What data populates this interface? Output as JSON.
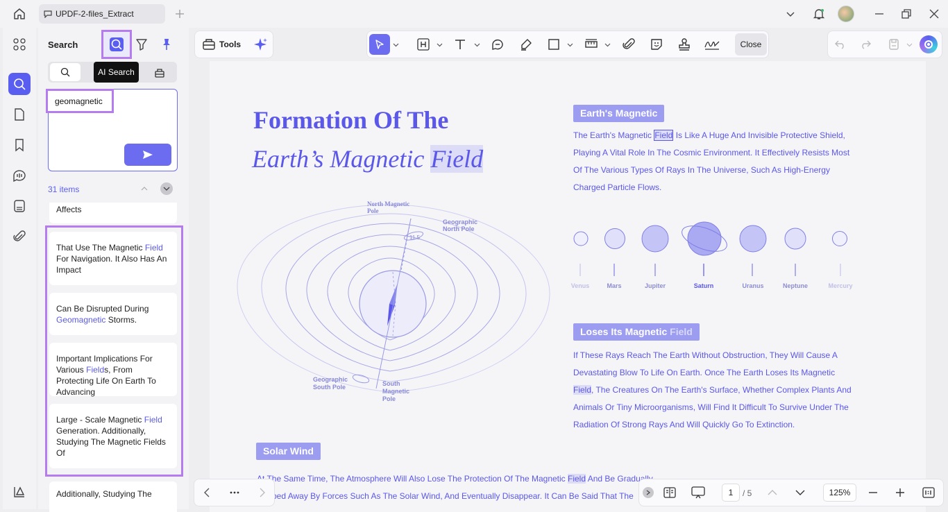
{
  "window": {
    "tab_title": "UPDF-2-files_Extract"
  },
  "search_panel": {
    "title": "Search",
    "tooltip": "AI Search",
    "query": "geomagnetic",
    "items_count": "31 items",
    "partial_top": "Affects",
    "results": [
      {
        "pre": "That Use The Magnetic ",
        "hl": "Field",
        "post": " For Navigation. It Also Has An Impact"
      },
      {
        "pre": "Can Be Disrupted During ",
        "hl": "Geomagnetic",
        "post": " Storms."
      },
      {
        "pre": "Important Implications For Various ",
        "hl": "Field",
        "post": "s, From Protecting Life On Earth To Advancing"
      },
      {
        "pre": "Large - Scale Magnetic ",
        "hl": "Field",
        "post": " Generation. Additionally, Studying The Magnetic Fields Of"
      }
    ],
    "partial_bottom": "Additionally, Studying The"
  },
  "toolbar": {
    "tools_label": "Tools",
    "close_label": "Close"
  },
  "document": {
    "title_line1": "Formation Of The",
    "title_line2_pre": "Earth’s Magnetic ",
    "title_line2_hl": "Field",
    "diagram_labels": {
      "north_magnetic": "North Magnetic Pole",
      "geo_north": "Geographic North Pole",
      "angle": "11.5",
      "geo_south": "Geographic South Pole",
      "south_pole": "South Magnetic Pole"
    },
    "sec1_heading": "Earth's Magnetic",
    "sec1_lines": [
      {
        "pre": "The Earth's Magnetic ",
        "hl": "Field",
        "post": " Is Like A Huge And Invisible Protective Shield,"
      },
      {
        "pre": "Playing A Vital Role In The Cosmic Environment. It Effectively Resists Most",
        "hl": "",
        "post": ""
      },
      {
        "pre": "Of The Various Types Of Rays In The Universe, Such As High-Energy",
        "hl": "",
        "post": ""
      },
      {
        "pre": "Charged Particle Flows.",
        "hl": "",
        "post": ""
      }
    ],
    "planets": [
      "Venus",
      "Mars",
      "Jupiter",
      "Saturn",
      "Uranus",
      "Neptune",
      "Mercury"
    ],
    "sec2_heading_pre": "Loses Its Magnetic ",
    "sec2_heading_hl": "Field",
    "sec2_lines": [
      {
        "pre": "If These Rays Reach The Earth Without Obstruction, They Will Cause A",
        "hl": "",
        "post": ""
      },
      {
        "pre": "Devastating Blow To Life On Earth. Once The Earth Loses Its Magnetic",
        "hl": "",
        "post": ""
      },
      {
        "pre": "",
        "hl": "Field",
        "post": ", The Creatures On The Earth's Surface, Whether Complex Plants And"
      },
      {
        "pre": "Animals Or Tiny Microorganisms, Will Find It Difficult To Survive Under The",
        "hl": "",
        "post": ""
      },
      {
        "pre": "Radiation Of Strong Rays And Will Quickly Go To Extinction.",
        "hl": "",
        "post": ""
      }
    ],
    "sec3_heading": "Solar Wind",
    "sec3_line1_pre": "At The Same Time, The Atmosphere Will Also Lose The Protection Of The Magnetic ",
    "sec3_line1_hl": "Field",
    "sec3_line1_post": " And Be Gradually",
    "sec3_line2": "ped Away By Forces Such As The Solar Wind, And Eventually Disappear. It Can Be Said That The"
  },
  "bottom_bar": {
    "page_current": "1",
    "page_total": "/ 5",
    "zoom": "125%"
  }
}
